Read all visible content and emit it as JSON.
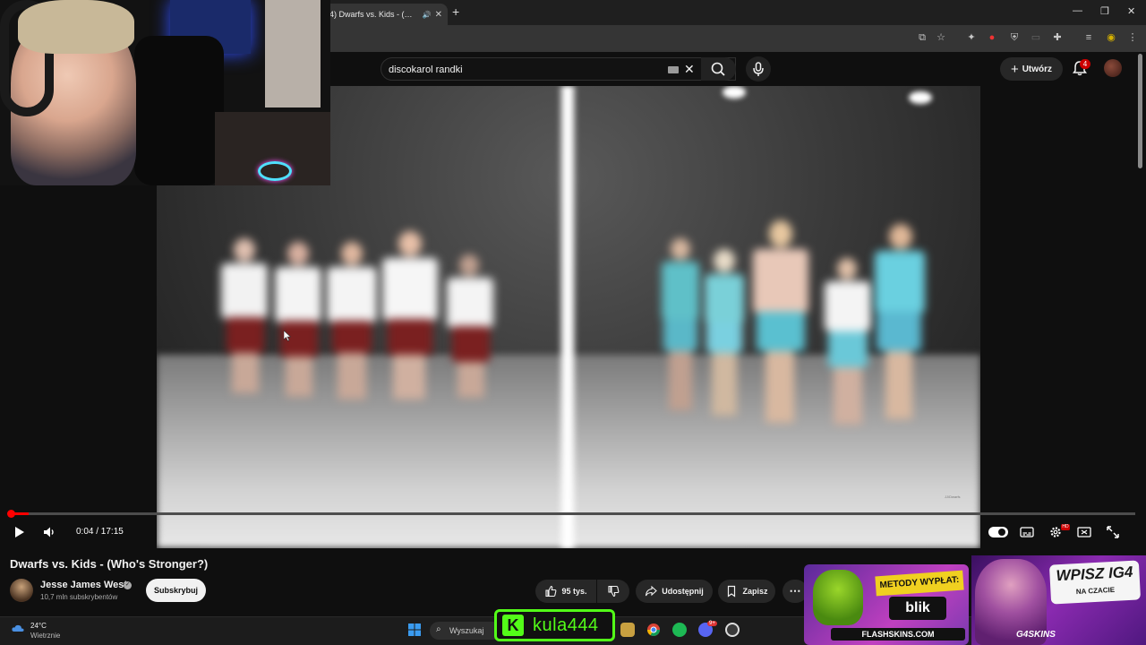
{
  "browser": {
    "tab_title": "4) Dwarfs vs. Kids - (Who's",
    "tab_audio_icon": "speaker-icon",
    "new_tab_label": "+",
    "close_tab_label": "✕",
    "window_controls": [
      "—",
      "❐",
      "✕"
    ]
  },
  "header": {
    "search_value": "discokarol randki",
    "create_label": "Utwórz",
    "notification_count": "4"
  },
  "player": {
    "current_time": "0:04",
    "duration": "17:15",
    "time_display": "0:04 / 17:15",
    "progress_fraction": 0.004,
    "watermark": "JJ/Dwarfs"
  },
  "video": {
    "title": "Dwarfs vs. Kids - (Who's Stronger?)",
    "channel_name": "Jesse James West",
    "subscribers": "10,7 mln subskrybentów",
    "subscribe_label": "Subskrybuj",
    "likes": "95 tys.",
    "share_label": "Udostępnij",
    "save_label": "Zapisz",
    "more_label": "⋯"
  },
  "taskbar": {
    "temperature": "24°C",
    "weather": "Wietrznie",
    "search_label": "Wyszukaj",
    "discord_badge": "9+"
  },
  "overlays": {
    "kick_username": "kula444",
    "kick_logo": "K",
    "ad1_banner": "METODY WYPŁAT:",
    "ad1_payment": "blik",
    "ad1_brand": "FLASHSKINS.COM",
    "ad2_headline": "WPISZ IG4",
    "ad2_subline": "NA CZACIE",
    "ad2_brand": "G4SKINS"
  },
  "colors": {
    "yt_background": "#0f0f0f",
    "progress_red": "#ff0000",
    "kick_green": "#53fc18"
  }
}
